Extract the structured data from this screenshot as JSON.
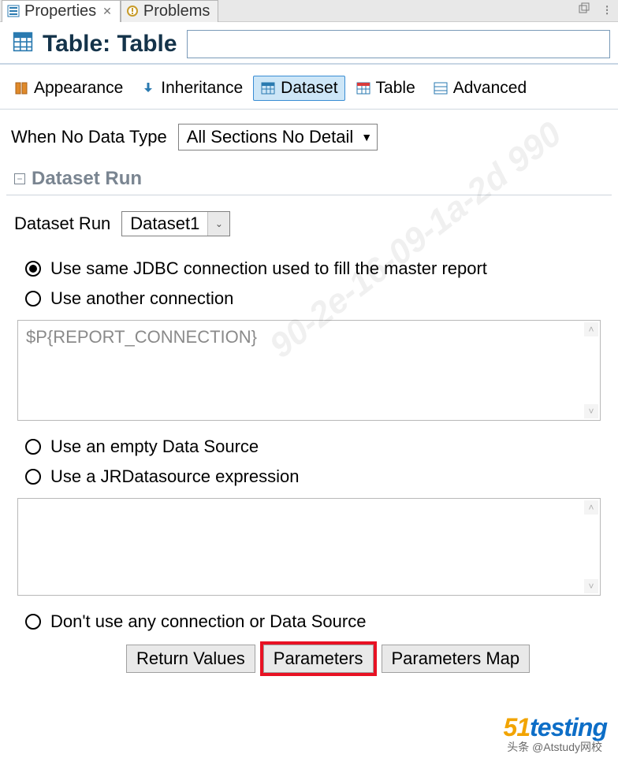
{
  "tabs": {
    "properties": "Properties",
    "problems": "Problems"
  },
  "title": {
    "label": "Table: Table"
  },
  "toolbar": {
    "appearance": "Appearance",
    "inheritance": "Inheritance",
    "dataset": "Dataset",
    "table": "Table",
    "advanced": "Advanced"
  },
  "form": {
    "whenNoDataLabel": "When No Data Type",
    "whenNoDataValue": "All Sections No Detail"
  },
  "section": {
    "datasetRun": "Dataset Run"
  },
  "datasetRun": {
    "label": "Dataset Run",
    "value": "Dataset1"
  },
  "options": {
    "sameJdbc": "Use same JDBC connection used to fill the master report",
    "anotherConn": "Use another connection",
    "connExpr": "$P{REPORT_CONNECTION}",
    "emptyDs": "Use an empty Data Source",
    "jrExpr": "Use a JRDatasource expression",
    "noConn": "Don't use any connection or Data Source"
  },
  "buttons": {
    "returnValues": "Return Values",
    "parameters": "Parameters",
    "parametersMap": "Parameters Map"
  },
  "watermark": "90-2e-16-09-1a-2d 990",
  "logo": {
    "a": "51",
    "b": "testing"
  },
  "byline": "头条 @Atstudy网校"
}
